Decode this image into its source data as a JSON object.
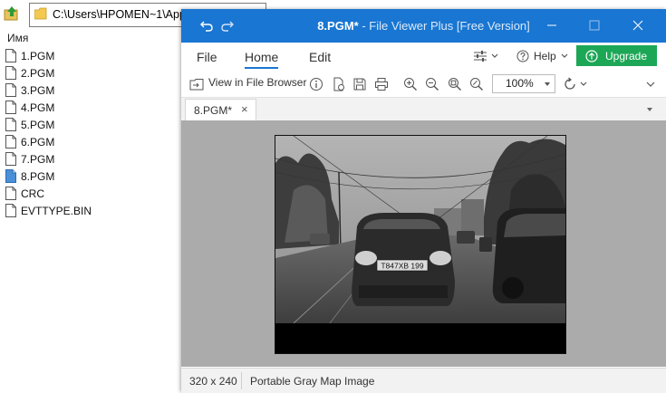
{
  "explorer": {
    "address": "C:\\Users\\HPOMEN~1\\Appl",
    "column_header": "Имя",
    "files": [
      {
        "name": "1.PGM",
        "selected": false
      },
      {
        "name": "2.PGM",
        "selected": false
      },
      {
        "name": "3.PGM",
        "selected": false
      },
      {
        "name": "4.PGM",
        "selected": false
      },
      {
        "name": "5.PGM",
        "selected": false
      },
      {
        "name": "6.PGM",
        "selected": false
      },
      {
        "name": "7.PGM",
        "selected": false
      },
      {
        "name": "8.PGM",
        "selected": true
      },
      {
        "name": "CRC",
        "selected": false
      },
      {
        "name": "EVTTYPE.BIN",
        "selected": false
      }
    ]
  },
  "window": {
    "title_document": "8.PGM*",
    "title_app": " - File Viewer Plus [Free Version]",
    "titlebar_color": "#1976d2"
  },
  "menu": {
    "file": "File",
    "home": "Home",
    "edit": "Edit",
    "help": "Help",
    "upgrade": "Upgrade",
    "upgrade_color": "#1ca756"
  },
  "toolbar": {
    "view_in_file_browser": "View in File Browser",
    "zoom_value": "100%"
  },
  "tab": {
    "label": "8.PGM*",
    "close": "×"
  },
  "image": {
    "plate": "T847XB 199"
  },
  "status": {
    "dimensions": "320 x 240",
    "file_type": "Portable Gray Map Image"
  }
}
